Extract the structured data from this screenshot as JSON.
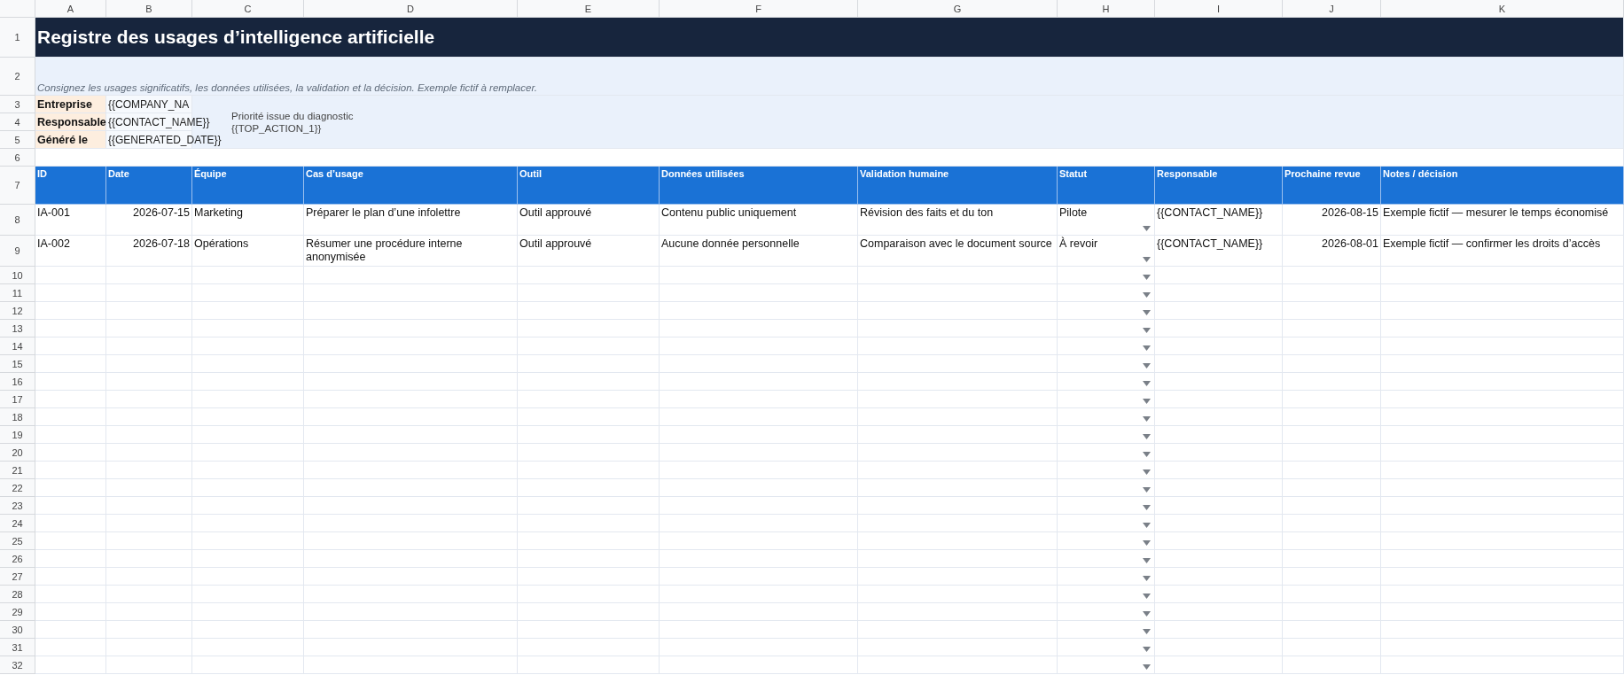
{
  "column_letters": [
    "A",
    "B",
    "C",
    "D",
    "E",
    "F",
    "G",
    "H",
    "I",
    "J",
    "K"
  ],
  "title": {
    "row": "1",
    "text": "Registre des usages d’intelligence artificielle"
  },
  "subtitle": {
    "row": "2",
    "text": "Consignez les usages significatifs, les données utilisées, la validation et la décision. Exemple fictif à remplacer."
  },
  "info": [
    {
      "row": "3",
      "label": "Entreprise",
      "value": "{{COMPANY_NA"
    },
    {
      "row": "4",
      "label": "Responsable",
      "value": "{{CONTACT_NAME}}"
    },
    {
      "row": "5",
      "label": "Généré le",
      "value": "{{GENERATED_DATE}}"
    }
  ],
  "note": {
    "lines": [
      "Priorité issue du diagnostic",
      "{{TOP_ACTION_1}}"
    ]
  },
  "spacer_row": "6",
  "header": {
    "row": "7",
    "columns": [
      {
        "label": "ID",
        "kind": "text"
      },
      {
        "label": "Date",
        "kind": "date"
      },
      {
        "label": "Équipe",
        "kind": "text"
      },
      {
        "label": "Cas d’usage",
        "kind": "text"
      },
      {
        "label": "Outil",
        "kind": "text"
      },
      {
        "label": "Données utilisées",
        "kind": "text"
      },
      {
        "label": "Validation humaine",
        "kind": "text"
      },
      {
        "label": "Statut",
        "kind": "dropdown"
      },
      {
        "label": "Responsable",
        "kind": "text"
      },
      {
        "label": "Prochaine revue",
        "kind": "date"
      },
      {
        "label": "Notes / décision",
        "kind": "text"
      }
    ]
  },
  "rows": [
    {
      "number": "8",
      "cells": [
        "IA-001",
        "2026-07-15",
        "Marketing",
        "Préparer le plan d’une infolettre",
        "Outil approuvé",
        "Contenu public uniquement",
        "Révision des faits et du ton",
        "Pilote",
        "{{CONTACT_NAME}}",
        "2026-08-15",
        "Exemple fictif — mesurer le temps économisé"
      ]
    },
    {
      "number": "9",
      "cells": [
        "IA-002",
        "2026-07-18",
        "Opérations",
        "Résumer une procédure interne anonymisée",
        "Outil approuvé",
        "Aucune donnée personnelle",
        "Comparaison avec le document source",
        "À revoir",
        "{{CONTACT_NAME}}",
        "2026-08-01",
        "Exemple fictif — confirmer les droits d’accès"
      ]
    },
    {
      "number": "10",
      "cells": []
    },
    {
      "number": "11",
      "cells": []
    },
    {
      "number": "12",
      "cells": []
    },
    {
      "number": "13",
      "cells": []
    },
    {
      "number": "14",
      "cells": []
    },
    {
      "number": "15",
      "cells": []
    },
    {
      "number": "16",
      "cells": []
    },
    {
      "number": "17",
      "cells": []
    },
    {
      "number": "18",
      "cells": []
    },
    {
      "number": "19",
      "cells": []
    },
    {
      "number": "20",
      "cells": []
    },
    {
      "number": "21",
      "cells": []
    },
    {
      "number": "22",
      "cells": []
    },
    {
      "number": "23",
      "cells": []
    },
    {
      "number": "24",
      "cells": []
    },
    {
      "number": "25",
      "cells": []
    },
    {
      "number": "26",
      "cells": []
    },
    {
      "number": "27",
      "cells": []
    },
    {
      "number": "28",
      "cells": []
    },
    {
      "number": "29",
      "cells": []
    },
    {
      "number": "30",
      "cells": []
    },
    {
      "number": "31",
      "cells": []
    },
    {
      "number": "32",
      "cells": []
    }
  ]
}
